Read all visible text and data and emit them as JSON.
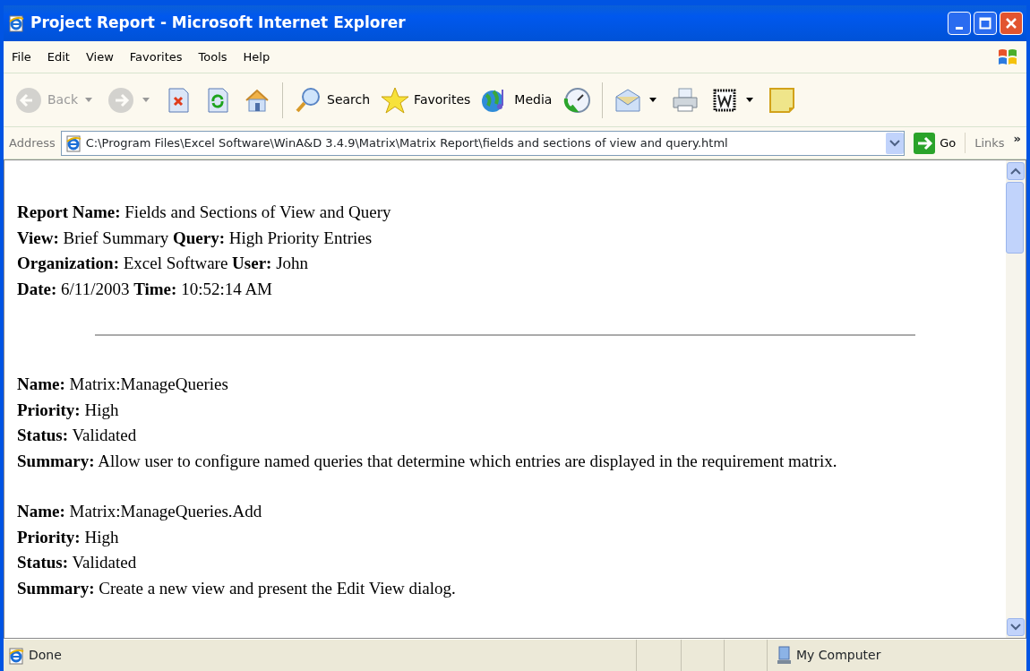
{
  "window": {
    "title": "Project Report - Microsoft Internet Explorer"
  },
  "menu": [
    "File",
    "Edit",
    "View",
    "Favorites",
    "Tools",
    "Help"
  ],
  "toolbar": [
    {
      "kind": "back",
      "label": "Back",
      "dropdown": true,
      "disabled": true
    },
    {
      "kind": "forward",
      "dropdown": true,
      "disabled": true
    },
    {
      "kind": "stop",
      "dropdown": false,
      "disabled": false
    },
    {
      "kind": "refresh",
      "dropdown": false,
      "disabled": false
    },
    {
      "kind": "home",
      "dropdown": false,
      "disabled": false
    },
    {
      "kind": "sep"
    },
    {
      "kind": "search",
      "label": "Search",
      "dropdown": false,
      "disabled": false
    },
    {
      "kind": "favorites",
      "label": "Favorites",
      "dropdown": false,
      "disabled": false
    },
    {
      "kind": "media",
      "label": "Media",
      "dropdown": false,
      "disabled": false
    },
    {
      "kind": "history",
      "dropdown": false,
      "disabled": false
    },
    {
      "kind": "sep"
    },
    {
      "kind": "mail",
      "dropdown": true,
      "disabled": false
    },
    {
      "kind": "print",
      "dropdown": false,
      "disabled": false
    },
    {
      "kind": "edit",
      "dropdown": true,
      "disabled": false
    },
    {
      "kind": "note",
      "dropdown": false,
      "disabled": false
    }
  ],
  "address": {
    "label": "Address",
    "value": "C:\\Program Files\\Excel Software\\WinA&D 3.4.9\\Matrix\\Matrix Report\\fields and sections of view and query.html"
  },
  "go_button": "Go",
  "links": "Links",
  "links_more": "»",
  "report": {
    "header": [
      "**Report Name:** Fields and Sections of View and Query",
      "**View:** Brief Summary **Query:** High Priority Entries",
      "**Organization:** Excel Software **User:** John",
      "**Date:** 6/11/2003 **Time:** 10:52:14 AM"
    ],
    "entries": [
      {
        "lines": [
          "**Name:** Matrix:ManageQueries",
          "**Priority:** High",
          "**Status:** Validated",
          "**Summary:** Allow user to configure named queries that determine which entries are displayed in the requirement matrix."
        ]
      },
      {
        "lines": [
          "**Name:** Matrix:ManageQueries.Add",
          "**Priority:** High",
          "**Status:** Validated",
          "**Summary:** Create a new view and present the Edit View dialog."
        ]
      }
    ]
  },
  "status_bar": {
    "text": "Done",
    "zone": "My Computer"
  }
}
